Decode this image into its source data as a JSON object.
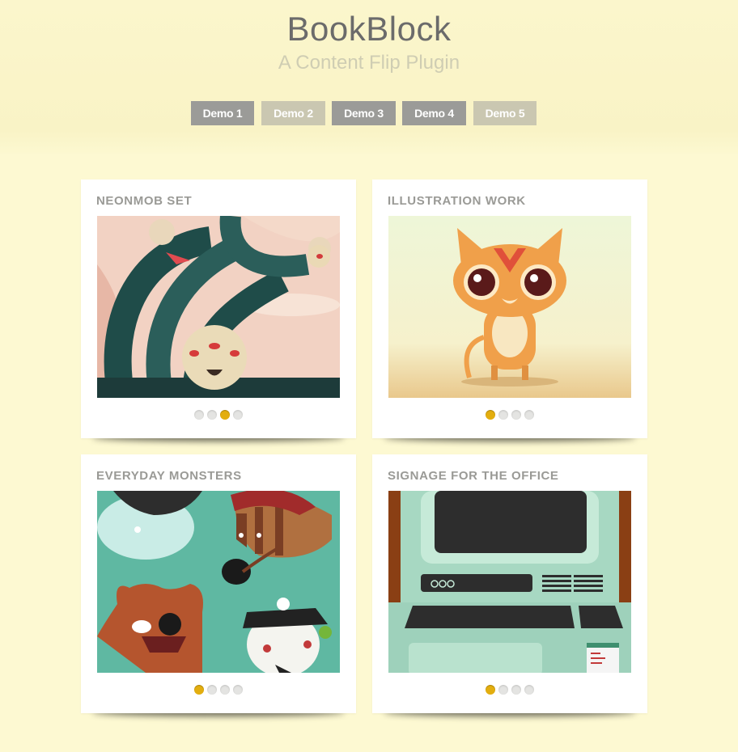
{
  "header": {
    "title": "BookBlock",
    "subtitle": "A Content Flip Plugin"
  },
  "demos": [
    {
      "label": "Demo 1",
      "state": "dark"
    },
    {
      "label": "Demo 2",
      "state": "light"
    },
    {
      "label": "Demo 3",
      "state": "dark"
    },
    {
      "label": "Demo 4",
      "state": "dark"
    },
    {
      "label": "Demo 5",
      "state": "light"
    }
  ],
  "cards": [
    {
      "title": "NEONMOB SET",
      "image": "monster-tentacles-illustration",
      "slides": 4,
      "active_slide": 3
    },
    {
      "title": "ILLUSTRATION WORK",
      "image": "orange-cat-illustration",
      "slides": 4,
      "active_slide": 1
    },
    {
      "title": "EVERYDAY MONSTERS",
      "image": "pirate-monsters-illustration",
      "slides": 4,
      "active_slide": 1
    },
    {
      "title": "SIGNAGE FOR THE OFFICE",
      "image": "retro-computer-illustration",
      "slides": 4,
      "active_slide": 1
    }
  ],
  "colors": {
    "background": "#fdf9d2",
    "accent_dot": "#e3ae0f",
    "button_dark": "#9b9b98",
    "button_light": "#cac7b1"
  }
}
